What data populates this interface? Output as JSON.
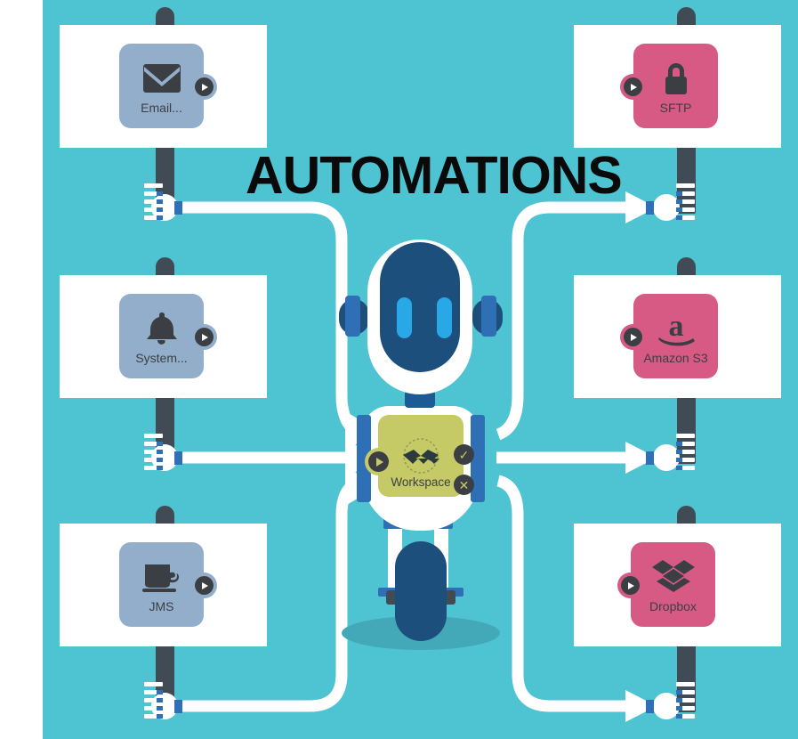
{
  "page": {
    "title": "AUTOMATIONS",
    "background_color": "#4ec3d1",
    "margin_color": "#ffffff"
  },
  "colors": {
    "teal_background": "#4ec3d1",
    "source_node": "#93aecb",
    "destination_node": "#d65a84",
    "workspace_node": "#c5ca67",
    "post_dark": "#414b55",
    "cable_white": "#ffffff",
    "robot_navy": "#1c4f7c",
    "robot_blue": "#2f6fb5",
    "robot_eye": "#29a8e8",
    "badge_dark": "#3b3f44"
  },
  "sources": [
    {
      "label": "Email...",
      "icon": "envelope-icon",
      "color": "#93aecb",
      "play_label": "Run"
    },
    {
      "label": "System...",
      "icon": "bell-icon",
      "color": "#93aecb",
      "play_label": "Run"
    },
    {
      "label": "JMS",
      "icon": "coffee-cup-icon",
      "color": "#93aecb",
      "play_label": "Run"
    }
  ],
  "destinations": [
    {
      "label": "SFTP",
      "icon": "lock-icon",
      "color": "#d65a84",
      "play_label": "Run"
    },
    {
      "label": "Amazon S3",
      "icon": "amazon-icon",
      "color": "#d65a84",
      "play_label": "Run"
    },
    {
      "label": "Dropbox",
      "icon": "dropbox-icon",
      "color": "#d65a84",
      "play_label": "Run"
    }
  ],
  "workspace": {
    "label": "Workspace",
    "logo": "circular-seal-logo",
    "play_label": "Run",
    "success_label": "✓",
    "error_label": "✕",
    "color": "#c5ca67"
  },
  "robot": {
    "name": "automation-robot",
    "eye_count": 2
  }
}
